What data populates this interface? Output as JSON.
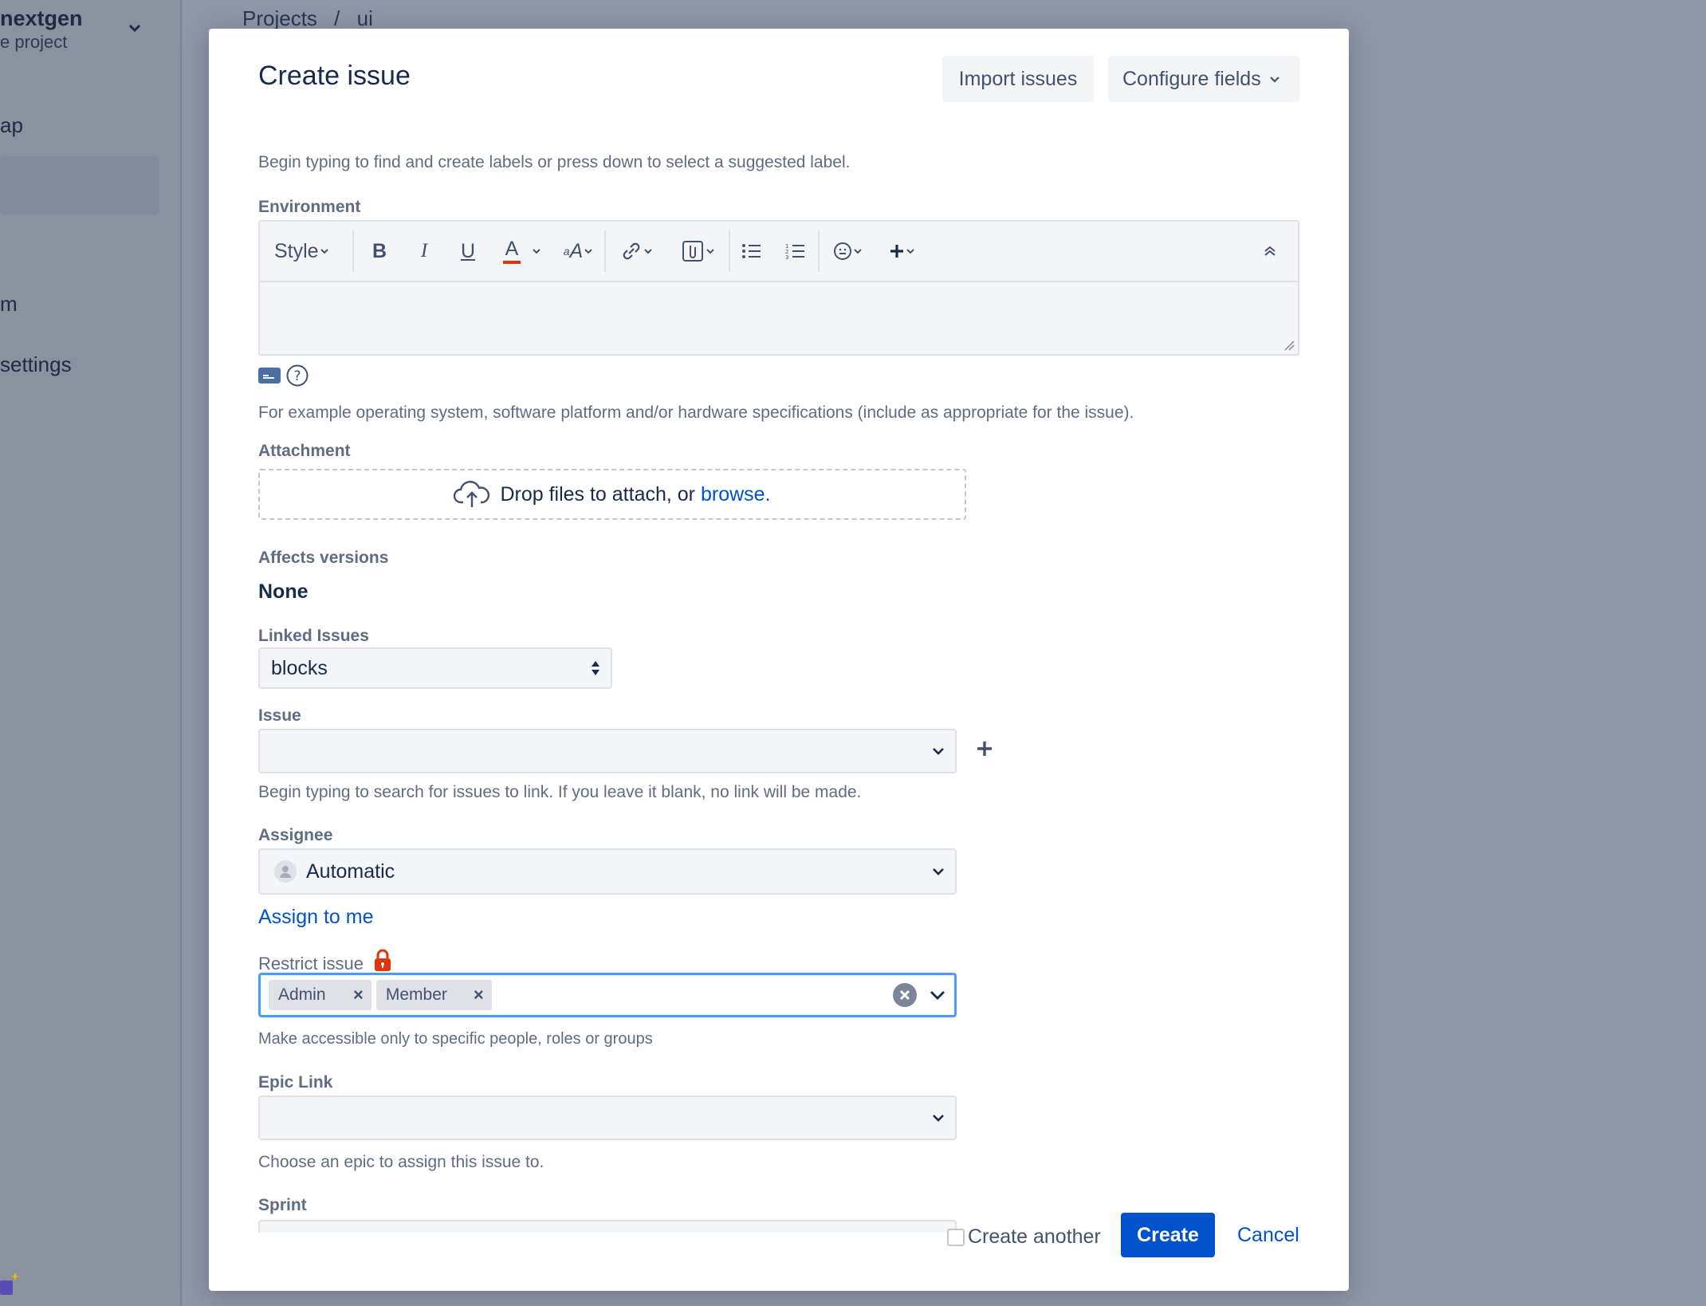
{
  "sidebar": {
    "project_name": "nextgen",
    "project_sub": "e project",
    "items": [
      {
        "label": "ap"
      },
      {
        "label": "m"
      },
      {
        "label": "settings"
      }
    ]
  },
  "breadcrumb": {
    "items": [
      "Projects",
      "/",
      "ui"
    ]
  },
  "modal": {
    "title": "Create issue",
    "import_label": "Import issues",
    "configure_label": "Configure fields"
  },
  "form": {
    "labels_help": "Begin typing to find and create labels or press down to select a suggested label.",
    "environment": {
      "label": "Environment",
      "style_label": "Style",
      "help": "For example operating system, software platform and/or hardware specifications (include as appropriate for the issue)."
    },
    "attachment": {
      "label": "Attachment",
      "drop_text": "Drop files to attach, or",
      "browse_text": "browse."
    },
    "affects_versions": {
      "label": "Affects versions",
      "value": "None"
    },
    "linked_issues": {
      "label": "Linked Issues",
      "value": "blocks"
    },
    "issue": {
      "label": "Issue",
      "help": "Begin typing to search for issues to link. If you leave it blank, no link will be made."
    },
    "assignee": {
      "label": "Assignee",
      "value": "Automatic",
      "assign_me": "Assign to me"
    },
    "restrict": {
      "label": "Restrict issue",
      "tags": [
        "Admin",
        "Member"
      ],
      "help": "Make accessible only to specific people, roles or groups"
    },
    "epic_link": {
      "label": "Epic Link",
      "help": "Choose an epic to assign this issue to."
    },
    "sprint": {
      "label": "Sprint"
    }
  },
  "footer": {
    "create_another": "Create another",
    "create": "Create",
    "cancel": "Cancel"
  },
  "colors": {
    "primary": "#0052cc",
    "focus": "#4c9aff",
    "lock": "#de350b"
  }
}
